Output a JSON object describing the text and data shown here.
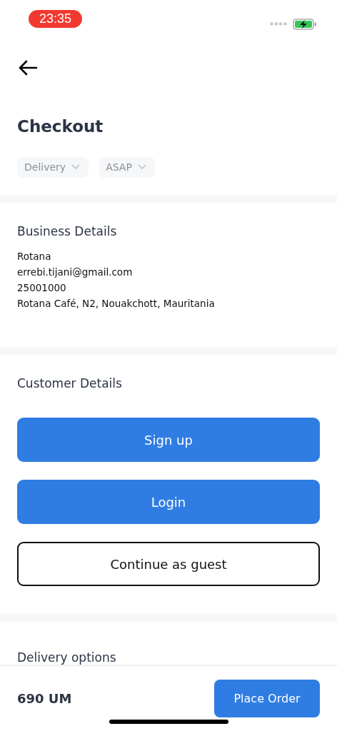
{
  "status_bar": {
    "time": "23:35"
  },
  "header": {
    "title": "Checkout"
  },
  "chips": [
    {
      "label": "Delivery"
    },
    {
      "label": "ASAP"
    }
  ],
  "business": {
    "heading": "Business Details",
    "lines": [
      "Rotana",
      "errebi.tijani@gmail.com",
      "25001000",
      "Rotana Café, N2, Nouakchott, Mauritania"
    ]
  },
  "customer": {
    "heading": "Customer Details",
    "buttons": [
      {
        "label": "Sign up",
        "kind": "primary"
      },
      {
        "label": "Login",
        "kind": "primary"
      },
      {
        "label": "Continue as guest",
        "kind": "outline"
      }
    ]
  },
  "delivery": {
    "heading": "Delivery options"
  },
  "footer": {
    "total": "690 UM",
    "button": "Place Order"
  }
}
